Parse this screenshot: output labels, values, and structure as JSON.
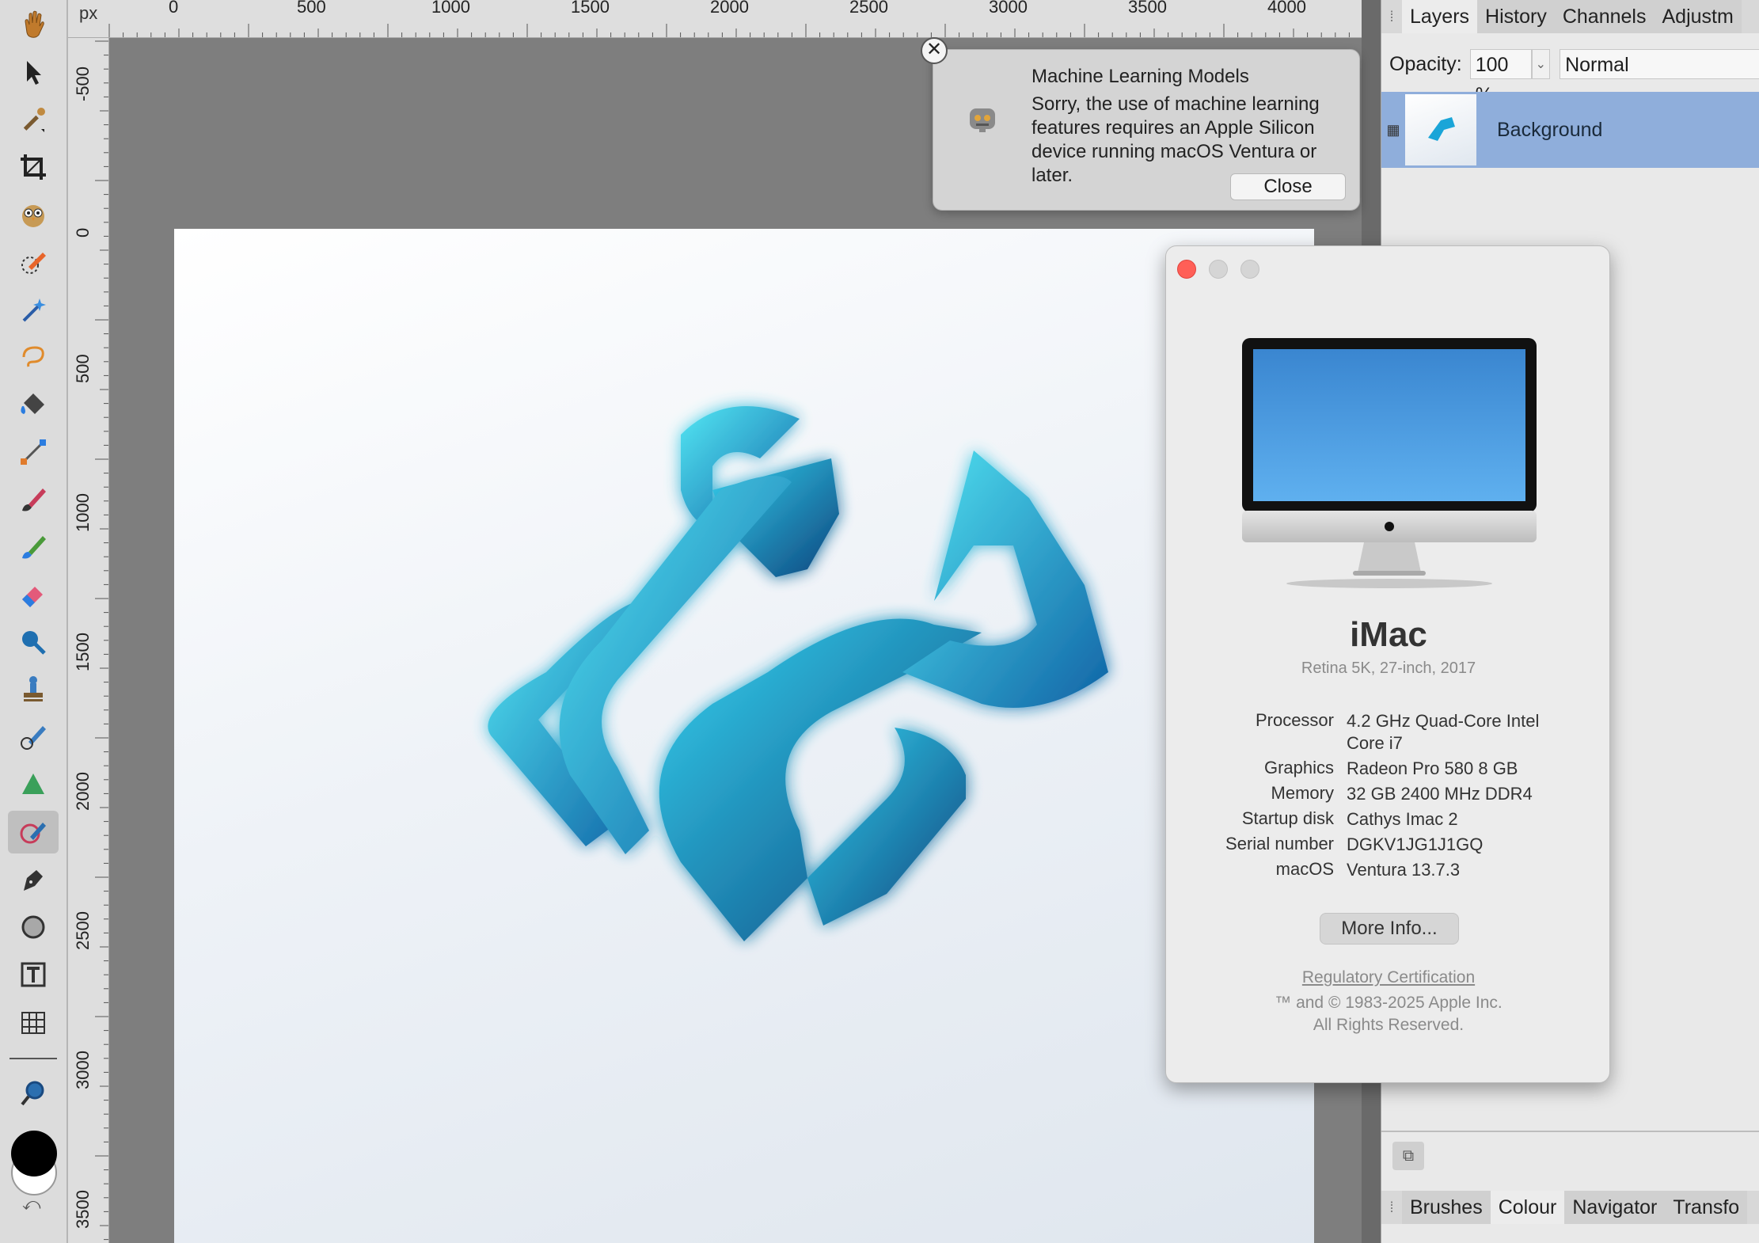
{
  "app": {
    "tools": [
      {
        "name": "view-hand-tool-icon"
      },
      {
        "name": "move-tool-icon"
      },
      {
        "name": "color-picker-tool-icon"
      },
      {
        "name": "crop-tool-icon"
      },
      {
        "name": "selection-brush-owl-icon"
      },
      {
        "name": "selection-brush-tool-icon"
      },
      {
        "name": "flood-select-tool-icon"
      },
      {
        "name": "freehand-selection-tool-icon"
      },
      {
        "name": "flood-fill-tool-icon"
      },
      {
        "name": "gradient-tool-icon"
      },
      {
        "name": "paint-brush-tool-icon"
      },
      {
        "name": "color-replacement-tool-icon"
      },
      {
        "name": "erase-brush-tool-icon"
      },
      {
        "name": "dodge-brush-tool-icon"
      },
      {
        "name": "clone-brush-tool-icon"
      },
      {
        "name": "blemish-removal-tool-icon"
      },
      {
        "name": "sharpen-brush-tool-icon"
      },
      {
        "name": "inpainting-brush-tool-icon"
      },
      {
        "name": "pen-tool-icon"
      },
      {
        "name": "ellipse-tool-icon"
      },
      {
        "name": "artistic-text-tool-icon"
      },
      {
        "name": "mesh-warp-tool-icon"
      },
      {
        "name": "zoom-tool-icon"
      }
    ],
    "primary_color": "#000000",
    "secondary_color": "#ffffff"
  },
  "rulers": {
    "unit": "px",
    "top_labels": [
      "0",
      "500",
      "1000",
      "1500",
      "2000",
      "2500",
      "3000",
      "3500",
      "4000"
    ],
    "left_labels": [
      "-500",
      "0",
      "500",
      "1000",
      "1500",
      "2000",
      "2500",
      "3000",
      "3500"
    ]
  },
  "panel": {
    "top_tabs": [
      "Layers",
      "History",
      "Channels",
      "Adjustm"
    ],
    "opacity_label": "Opacity:",
    "opacity_value": "100 %",
    "blend_mode": "Normal",
    "layer_name": "Background",
    "bottom_tabs": [
      "Brushes",
      "Colour",
      "Navigator",
      "Transfo"
    ],
    "accent": "#8faedb"
  },
  "toast": {
    "title": "Machine Learning Models",
    "message": "Sorry, the use of machine learning features requires an Apple Silicon device running macOS Ventura or later.",
    "close_label": "Close"
  },
  "about": {
    "model": "iMac",
    "subtitle": "Retina 5K, 27-inch, 2017",
    "specs": [
      {
        "key": "Processor",
        "value": "4.2 GHz Quad-Core Intel Core i7"
      },
      {
        "key": "Graphics",
        "value": "Radeon Pro 580 8 GB"
      },
      {
        "key": "Memory",
        "value": "32 GB 2400 MHz DDR4"
      },
      {
        "key": "Startup disk",
        "value": "Cathys Imac 2"
      },
      {
        "key": "Serial number",
        "value": "DGKV1JG1J1GQ"
      },
      {
        "key": "macOS",
        "value": "Ventura 13.7.3"
      }
    ],
    "more_info_label": "More Info...",
    "regulatory_label": "Regulatory Certification",
    "copyright_line1": "™ and © 1983-2025 Apple Inc.",
    "copyright_line2": "All Rights Reserved.",
    "close_color": "#ff5f57"
  }
}
